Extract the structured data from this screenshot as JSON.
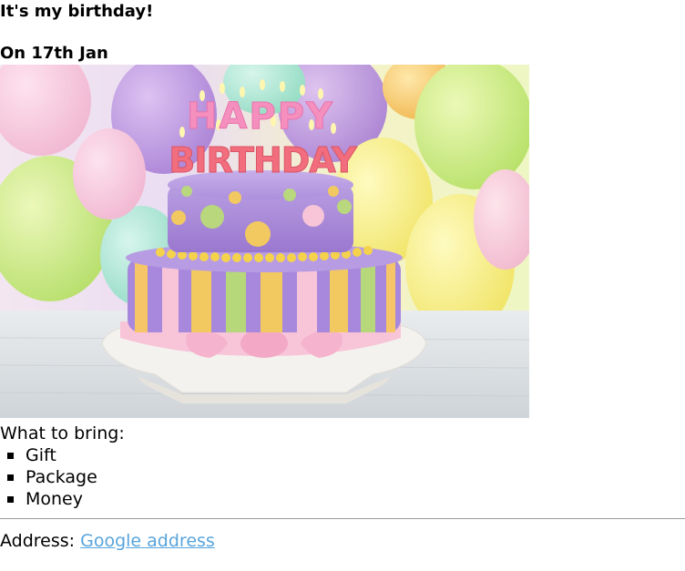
{
  "header": {
    "title": "It's my birthday!",
    "date": "On 17th Jan"
  },
  "photo": {
    "alt": "Birthday cake with HAPPY BIRTHDAY candles",
    "candles_top": "HAPPY",
    "candles_bottom": "BIRTHDAY"
  },
  "bring": {
    "label": "What to bring:",
    "items": [
      "Gift",
      "Package",
      "Money"
    ]
  },
  "address": {
    "label": "Address:",
    "link_text": "Google address"
  },
  "colors": {
    "link": "#58a4dc",
    "divider": "#9a9a9a"
  }
}
